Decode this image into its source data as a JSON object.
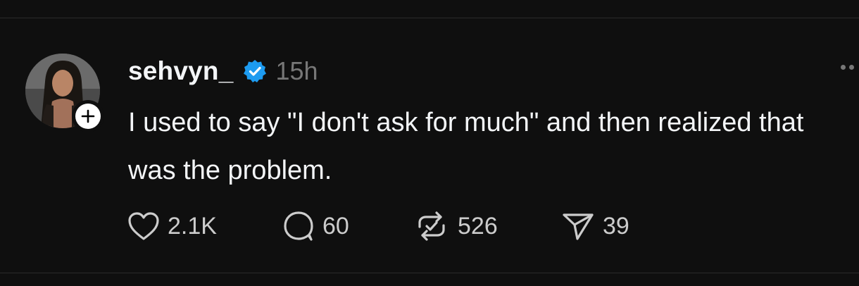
{
  "post": {
    "username": "sehvyn_",
    "verified": true,
    "timestamp": "15h",
    "text": "I used to say \"I don't ask for much\" and then realized that was the problem.",
    "actions": {
      "likes": "2.1K",
      "replies": "60",
      "reposts": "526",
      "shares": "39"
    }
  },
  "icons": {
    "verified": "verified-badge-icon",
    "follow": "plus-icon",
    "more": "more-horizontal-icon",
    "like": "heart-icon",
    "reply": "comment-icon",
    "repost": "repost-icon",
    "share": "send-icon"
  },
  "colors": {
    "background": "#0f0f0f",
    "text": "#f3f5f7",
    "muted": "#777777",
    "verified": "#1d9bf0"
  }
}
